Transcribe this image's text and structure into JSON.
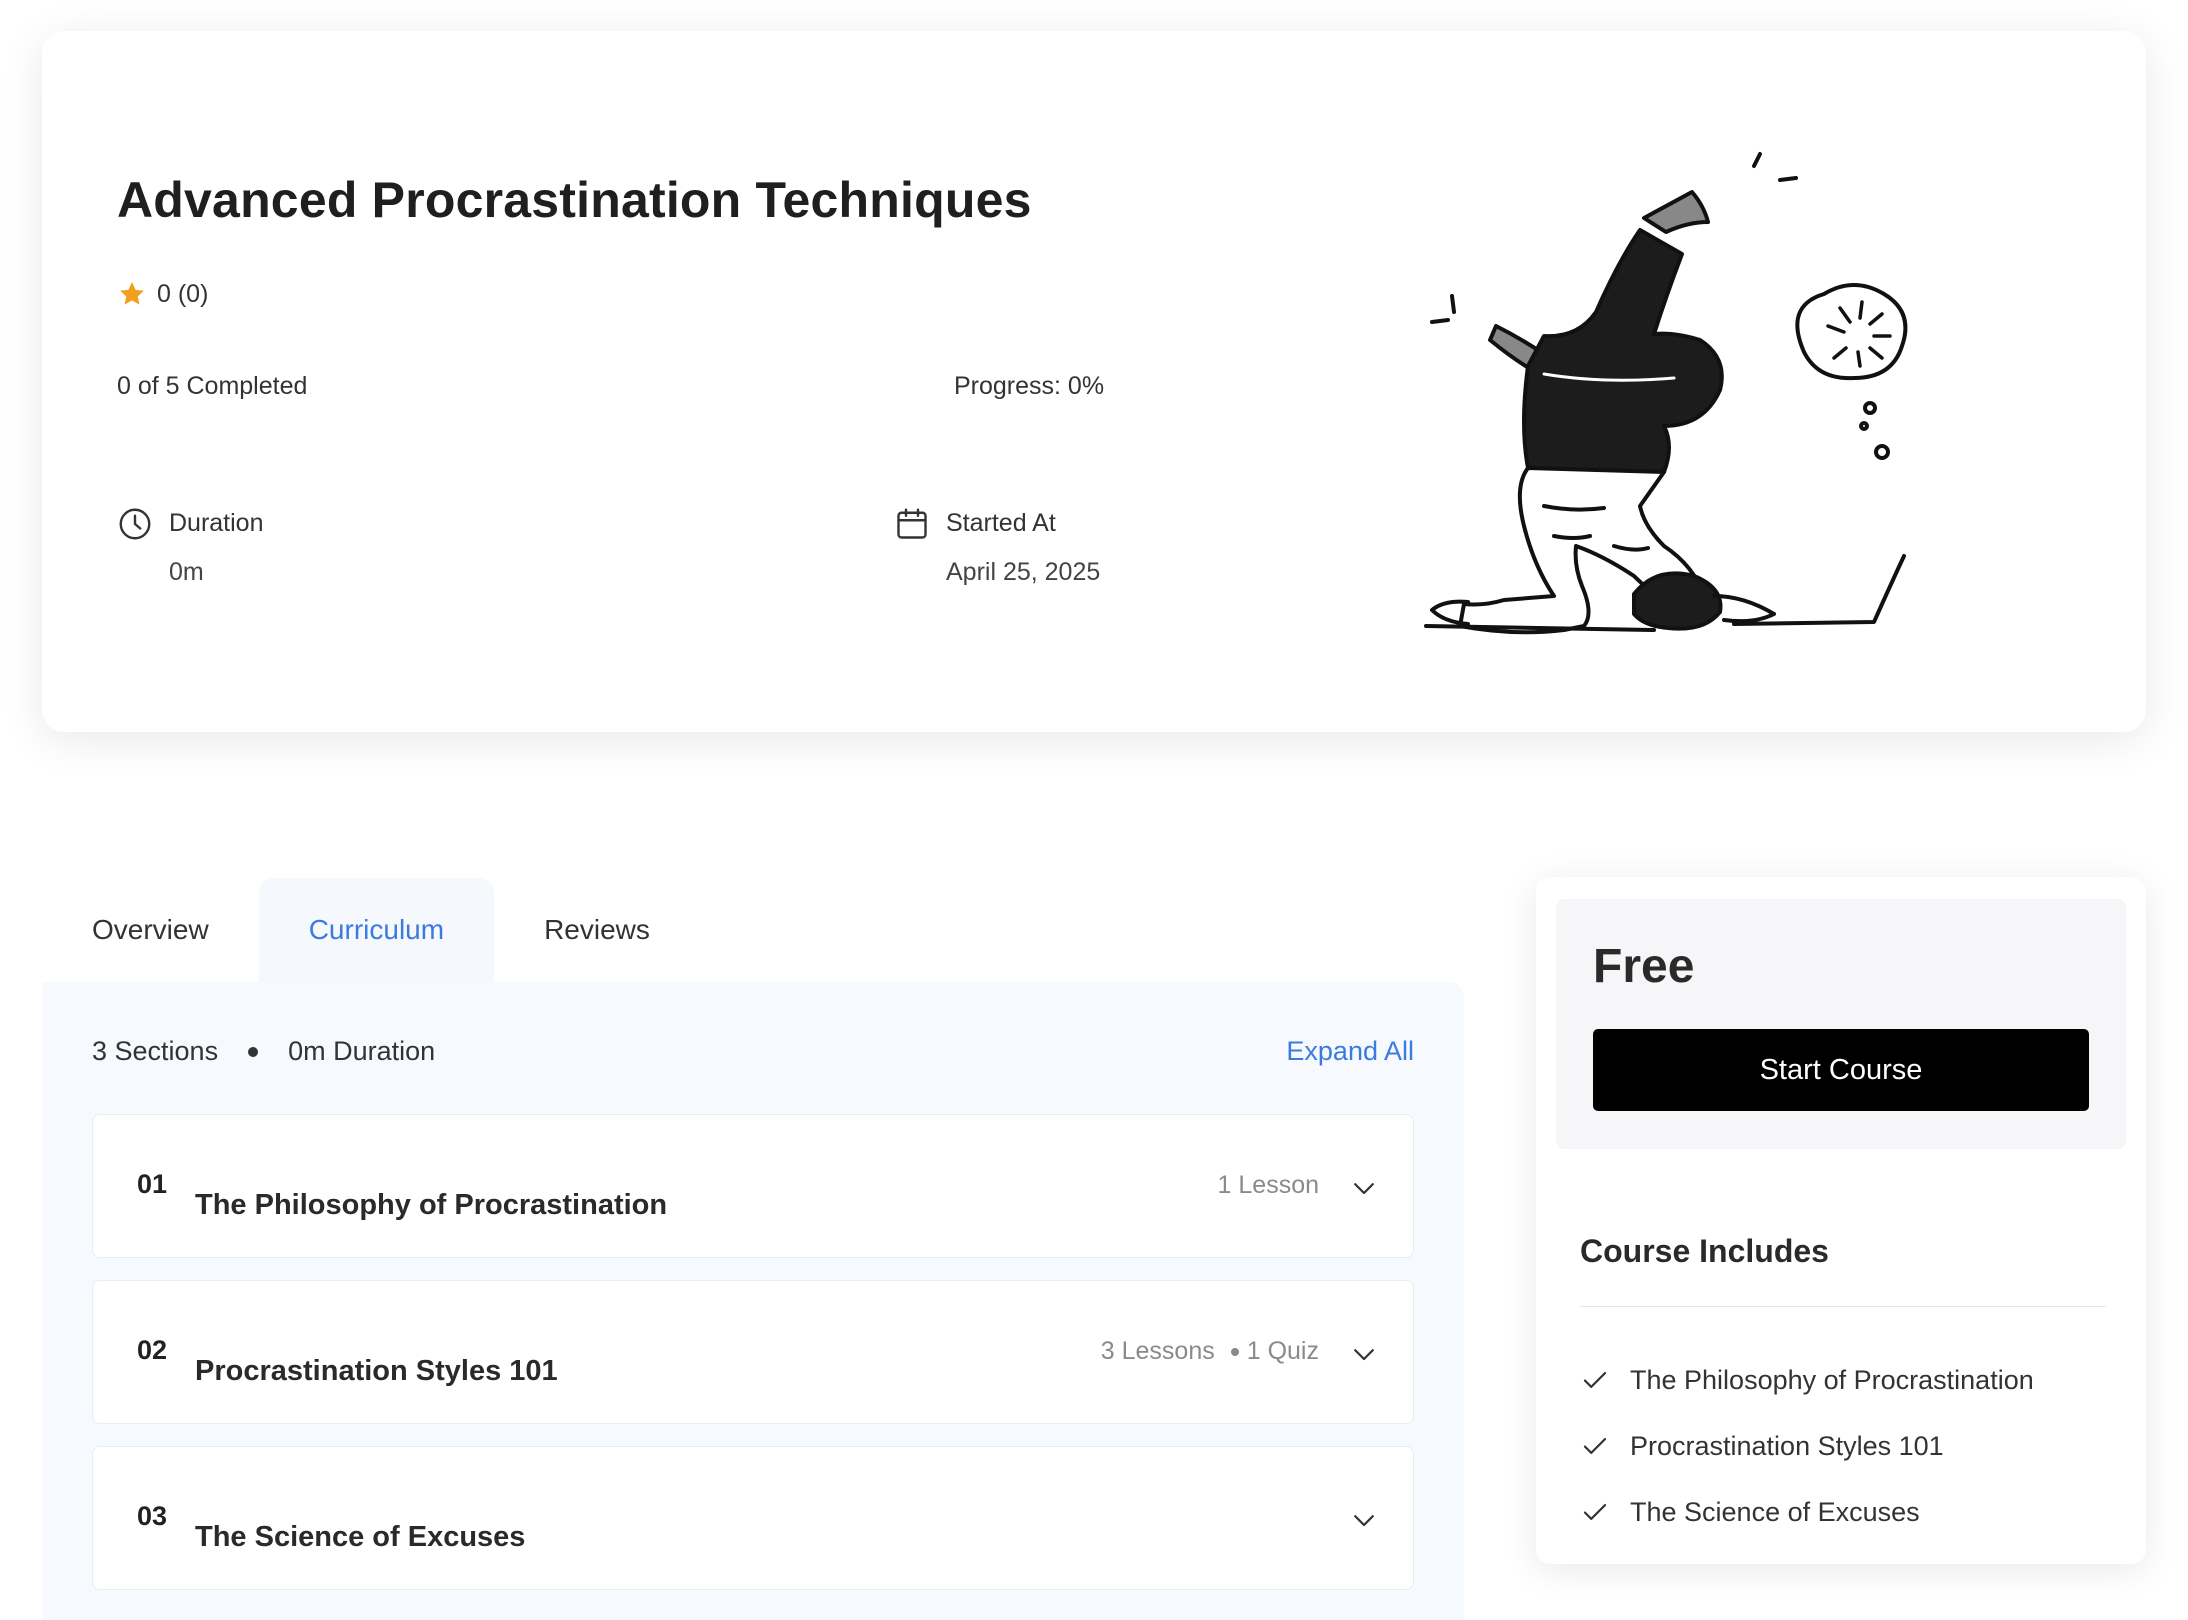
{
  "course": {
    "title": "Advanced Procrastination Techniques",
    "rating_text": "0 (0)",
    "completed_text": "0 of 5 Completed",
    "progress_text": "Progress: 0%",
    "progress_percent": 0,
    "duration_label": "Duration",
    "duration_value": "0m",
    "started_label": "Started At",
    "started_value": "April 25, 2025"
  },
  "tabs": [
    {
      "label": "Overview",
      "active": false
    },
    {
      "label": "Curriculum",
      "active": true
    },
    {
      "label": "Reviews",
      "active": false
    }
  ],
  "curriculum": {
    "sections_count": "3 Sections",
    "duration": "0m Duration",
    "expand_all": "Expand All",
    "sections": [
      {
        "number": "01",
        "title": "The Philosophy of Procrastination",
        "meta": [
          "1 Lesson"
        ]
      },
      {
        "number": "02",
        "title": "Procrastination Styles 101",
        "meta": [
          "3 Lessons",
          "1 Quiz"
        ]
      },
      {
        "number": "03",
        "title": "The Science of Excuses",
        "meta": []
      }
    ]
  },
  "sidebar": {
    "price": "Free",
    "start_button": "Start Course",
    "includes_title": "Course Includes",
    "includes": [
      "The Philosophy of Procrastination",
      "Procrastination Styles 101",
      "The Science of Excuses"
    ]
  },
  "colors": {
    "accent": "#3b7be0",
    "star": "#f0a020",
    "button_bg": "#000000"
  },
  "icons": {
    "rating": "star-icon",
    "duration": "clock-icon",
    "started": "calendar-icon",
    "section_toggle": "chevron-down-icon",
    "include_item": "check-icon"
  }
}
